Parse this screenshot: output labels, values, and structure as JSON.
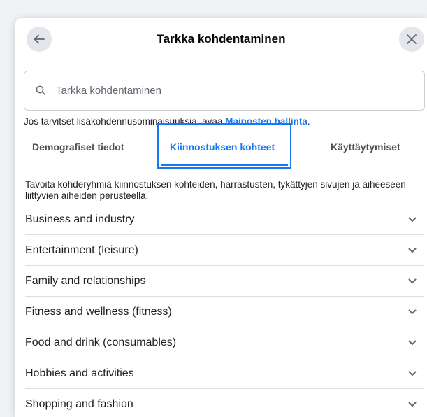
{
  "header": {
    "title": "Tarkka kohdentaminen"
  },
  "search": {
    "placeholder": "Tarkka kohdentaminen"
  },
  "hint": {
    "text": "Jos tarvitset lisäkohdennusominaisuuksia, avaa ",
    "link": "Mainosten hallinta",
    "suffix": "."
  },
  "tabs": [
    {
      "label": "Demografiset tiedot"
    },
    {
      "label": "Kiinnostuksen kohteet"
    },
    {
      "label": "Käyttäytymiset"
    }
  ],
  "description": "Tavoita kohderyhmiä kiinnostuksen kohteiden, harrastusten, tykättyjen sivujen ja aiheeseen liittyvien aiheiden perusteella.",
  "categories": [
    {
      "label": "Business and industry"
    },
    {
      "label": "Entertainment (leisure)"
    },
    {
      "label": "Family and relationships"
    },
    {
      "label": "Fitness and wellness (fitness)"
    },
    {
      "label": "Food and drink (consumables)"
    },
    {
      "label": "Hobbies and activities"
    },
    {
      "label": "Shopping and fashion"
    }
  ],
  "icons": {
    "back": "arrow-left-icon",
    "close": "close-icon",
    "search": "search-icon",
    "expand": "chevron-down-icon"
  },
  "colors": {
    "accent": "#1877f2",
    "button_bg": "#e4e6eb",
    "divider": "#dadde1"
  }
}
